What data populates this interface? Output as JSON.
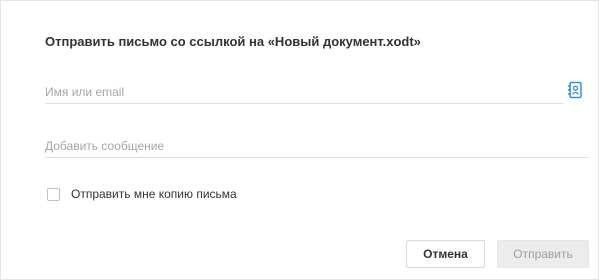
{
  "dialog": {
    "title": "Отправить письмо со ссылкой на «Новый документ.xodt»"
  },
  "form": {
    "name_placeholder": "Имя или email",
    "name_value": "",
    "message_placeholder": "Добавить сообщение",
    "message_value": "",
    "contacts_icon": "address-book-icon",
    "copy_checkbox_label": "Отправить мне копию письма",
    "copy_checked": false
  },
  "buttons": {
    "cancel_label": "Отмена",
    "send_label": "Отправить"
  },
  "colors": {
    "accent": "#3d8fd6",
    "border": "#e0e0e0",
    "disabled_button_bg": "#ececec",
    "disabled_button_text": "#a0a0a0"
  }
}
